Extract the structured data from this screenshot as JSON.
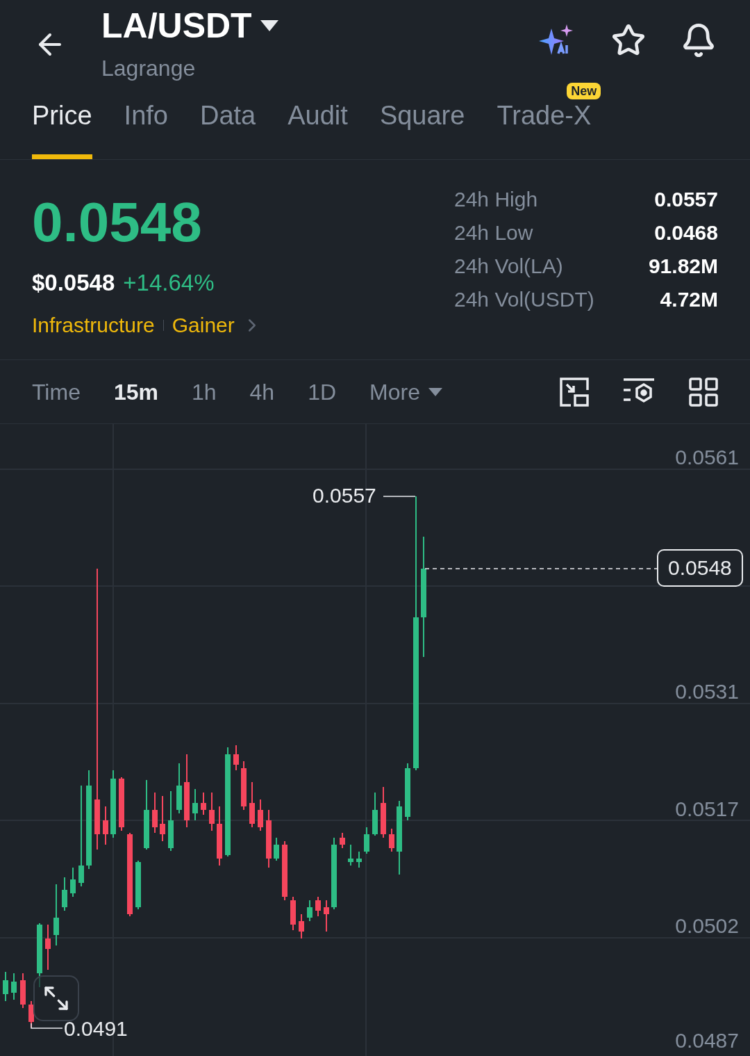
{
  "header": {
    "pair": "LA/USDT",
    "name": "Lagrange"
  },
  "tabs": [
    {
      "label": "Price",
      "selected": true
    },
    {
      "label": "Info",
      "selected": false
    },
    {
      "label": "Data",
      "selected": false
    },
    {
      "label": "Audit",
      "selected": false
    },
    {
      "label": "Square",
      "selected": false
    },
    {
      "label": "Trade-X",
      "selected": false,
      "badge": "New"
    }
  ],
  "price": {
    "last": "0.0548",
    "usd": "$0.0548",
    "change": "+14.64%",
    "tags": [
      "Infrastructure",
      "Gainer"
    ]
  },
  "stats": [
    {
      "label": "24h High",
      "value": "0.0557"
    },
    {
      "label": "24h Low",
      "value": "0.0468"
    },
    {
      "label": "24h Vol(LA)",
      "value": "91.82M"
    },
    {
      "label": "24h Vol(USDT)",
      "value": "4.72M"
    }
  ],
  "intervals": [
    {
      "label": "Time",
      "selected": false
    },
    {
      "label": "15m",
      "selected": true
    },
    {
      "label": "1h",
      "selected": false
    },
    {
      "label": "4h",
      "selected": false
    },
    {
      "label": "1D",
      "selected": false
    }
  ],
  "more": "More",
  "chart": {
    "y_labels": [
      "0.0561",
      "0.0531",
      "0.0517",
      "0.0502",
      "0.0487"
    ],
    "high_label": "0.0557",
    "low_label": "0.0491",
    "current_price": "0.0548"
  }
}
